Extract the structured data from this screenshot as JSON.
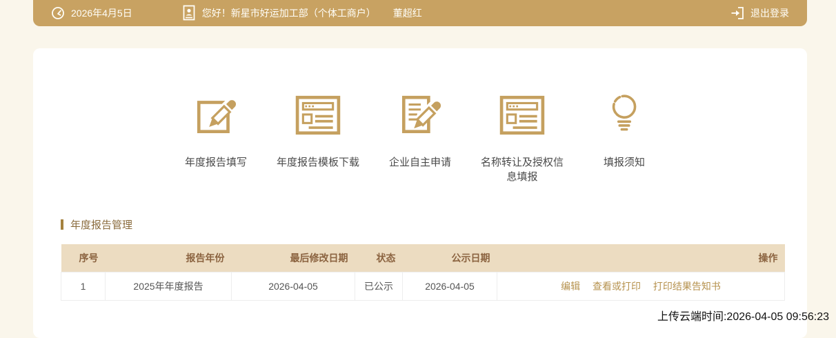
{
  "colors": {
    "topbar_bg": "#c8a262",
    "page_bg": "#faf6eb",
    "card_bg": "#ffffff",
    "icon_gold": "#c5a05f",
    "section_marker": "#a5823f",
    "section_title_text": "#8a6b3d",
    "table_header_bg": "#ecdcc1",
    "table_header_text": "#8b6340",
    "table_border": "#ededed",
    "link_gold": "#b6924e",
    "body_text": "#555555"
  },
  "topbar": {
    "date": "2026年4月5日",
    "greeting": "您好！新星市好运加工部（个体工商户）",
    "username": "董超红",
    "logout_label": "退出登录",
    "icons": [
      "clock-icon",
      "id-badge-icon",
      "logout-icon"
    ]
  },
  "quick_actions": [
    {
      "label": "年度报告填写",
      "icon": "edit-square-icon"
    },
    {
      "label": "年度报告模板下载",
      "icon": "template-window-icon"
    },
    {
      "label": "企业自主申请",
      "icon": "document-edit-icon"
    },
    {
      "label": "名称转让及授权信息填报",
      "icon": "name-transfer-window-icon"
    },
    {
      "label": "填报须知",
      "icon": "lightbulb-icon"
    }
  ],
  "report_section": {
    "title": "年度报告管理",
    "table": {
      "headers": [
        "序号",
        "报告年份",
        "最后修改日期",
        "状态",
        "公示日期",
        "操作"
      ],
      "rows": [
        {
          "index": "1",
          "report_year": "2025年年度报告",
          "last_modified": "2026-04-05",
          "status": "已公示",
          "publish_date": "2026-04-05",
          "actions": [
            "编辑",
            "查看或打印",
            "打印结果告知书"
          ]
        }
      ]
    }
  },
  "footer": {
    "upload_time": "上传云端时间:2026-04-05 09:56:23"
  }
}
